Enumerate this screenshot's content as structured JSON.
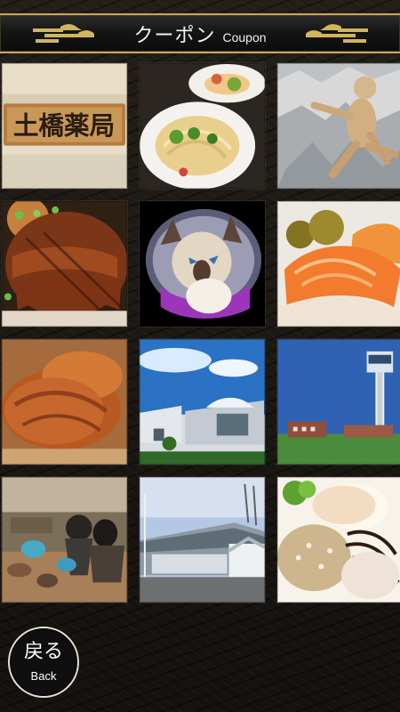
{
  "header": {
    "title_jp": "クーポン",
    "title_en": "Coupon"
  },
  "tiles": [
    {
      "name": "tile-sign",
      "sign_text": "土橋薬局"
    },
    {
      "name": "tile-pasta"
    },
    {
      "name": "tile-figure"
    },
    {
      "name": "tile-unagi"
    },
    {
      "name": "tile-cat"
    },
    {
      "name": "tile-pickles"
    },
    {
      "name": "tile-cutlet"
    },
    {
      "name": "tile-building"
    },
    {
      "name": "tile-tower"
    },
    {
      "name": "tile-pottery"
    },
    {
      "name": "tile-facility"
    },
    {
      "name": "tile-dish"
    }
  ],
  "back": {
    "label_jp": "戻る",
    "label_en": "Back"
  },
  "icons": {
    "ornament": "cloud-ornament-icon"
  }
}
